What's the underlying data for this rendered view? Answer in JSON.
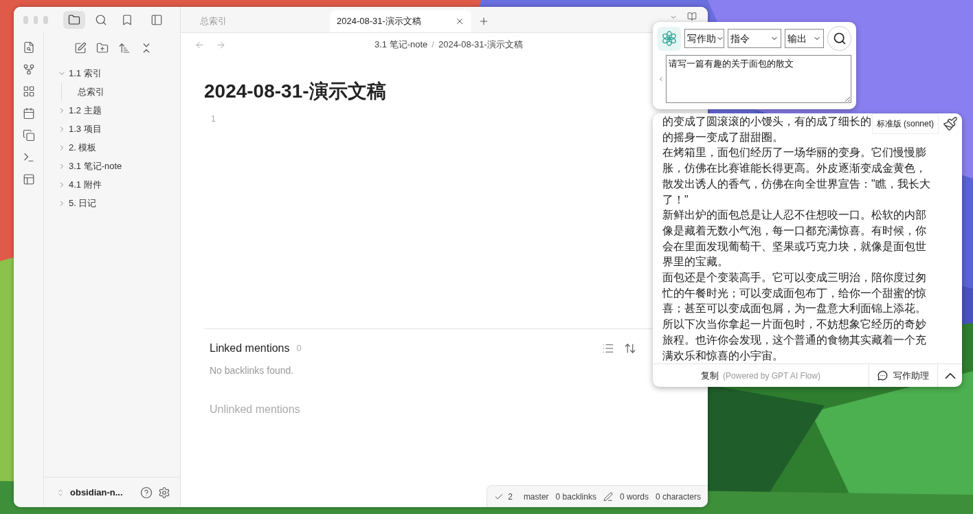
{
  "tabs": [
    {
      "label": "总索引",
      "selected": false
    },
    {
      "label": "2024-08-31-演示文稿",
      "selected": true
    }
  ],
  "file_tree": [
    {
      "label": "1.1 索引",
      "expanded": true,
      "children": [
        {
          "label": "总索引"
        }
      ]
    },
    {
      "label": "1.2 主题",
      "expanded": false
    },
    {
      "label": "1.3 项目",
      "expanded": false
    },
    {
      "label": "2. 模板",
      "expanded": false
    },
    {
      "label": "3.1 笔记-note",
      "expanded": false
    },
    {
      "label": "4.1 附件",
      "expanded": false
    },
    {
      "label": "5. 日记",
      "expanded": false
    }
  ],
  "vault": "obsidian-n...",
  "breadcrumb": {
    "items": [
      "3.1 笔记-note",
      "2024-08-31-演示文稿"
    ],
    "separator": "/"
  },
  "note": {
    "title": "2024-08-31-演示文稿",
    "line_number": "1"
  },
  "linked_mentions": {
    "title": "Linked mentions",
    "count": "0",
    "empty": "No backlinks found."
  },
  "unlinked_mentions": {
    "title": "Unlinked mentions"
  },
  "status_bar": {
    "sync": "2",
    "branch": "master",
    "backlinks": "0 backlinks",
    "words": "0 words",
    "characters": "0 characters"
  },
  "ai_panel": {
    "selects": [
      "写作助",
      "指令",
      "输出"
    ],
    "prompt": "请写一篇有趣的关于面包的散文",
    "model": "标准版 (sonnet)",
    "output": [
      "的变成了圆滚滚的小馒头，有的成了细长的",
      "的摇身一变成了甜甜圈。",
      "在烤箱里，面包们经历了一场华丽的变身。它们慢慢膨胀，仿佛在比赛谁能长得更高。外皮逐渐变成金黄色，散发出诱人的香气，仿佛在向全世界宣告：\"瞧，我长大了！\"",
      "新鲜出炉的面包总是让人忍不住想咬一口。松软的内部像是藏着无数小气泡，每一口都充满惊喜。有时候，你会在里面发现葡萄干、坚果或巧克力块，就像是面包世界里的宝藏。",
      "面包还是个变装高手。它可以变成三明治，陪你度过匆忙的午餐时光；可以变成面包布丁，给你一个甜蜜的惊喜；甚至可以变成面包屑，为一盘意大利面锦上添花。",
      "所以下次当你拿起一片面包时，不妨想象它经历的奇妙旅程。也许你会发现，这个普通的食物其实藏着一个充满欢乐和惊喜的小宇宙。"
    ],
    "copy": "复制",
    "powered": "(Powered by GPT AI Flow)",
    "assistant": "写作助理"
  }
}
